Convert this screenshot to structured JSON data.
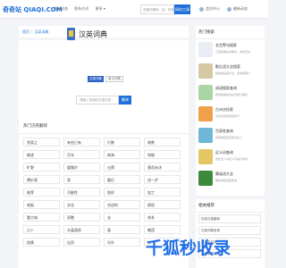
{
  "header": {
    "logo": "奇奇站 QIAQI.COM",
    "nav": [
      "新闻动态",
      "联系方式",
      "更多 ▾"
    ],
    "search_placeholder": "关键词搜索，如：短视频",
    "search_button": "网站工具",
    "user_a": "会员中心",
    "user_b": "最新动态"
  },
  "breadcrumb": {
    "home": "首页",
    "sep": "/",
    "current": "汉英词典"
  },
  "app": {
    "name": "汉英词典",
    "tag_primary": "汉英词典",
    "tag_secondary": "英汉词典"
  },
  "query": {
    "placeholder": "请输入查询的汉语词语",
    "button": "翻译"
  },
  "hot": {
    "title": "热门汉英翻译",
    "items": [
      "答案之",
      "有些已有",
      "行数",
      "装数",
      "概述",
      "百年",
      "商海",
      "铭物",
      "旷野",
      "缓慢步",
      "出殡",
      "悬而未决",
      "牌价表",
      "背",
      "最后",
      "进一步",
      "推荐",
      "可能性",
      "陪伴",
      "加工",
      "老板",
      "文化",
      "合适的",
      "债权",
      "重大城",
      "双胞",
      "去",
      "体系",
      "占卜",
      "水晶面前",
      "量",
      "集团",
      "陪情",
      "出资",
      "另外",
      "以"
    ]
  },
  "sidebar": {
    "title": "热门搜索",
    "apps": [
      {
        "name": "名言警句搜索",
        "desc": "汇聚经典名言警句，寻找灵感",
        "color": "#e9edf3"
      },
      {
        "name": "歇后语大全搜索",
        "desc": "精选歇后语大全，查询其释义",
        "color": "#d6c7a5"
      },
      {
        "name": "成语搜索查询",
        "desc": "搜索成语的出处及释义解析",
        "color": "#a9d6a3"
      },
      {
        "name": "古诗文检索",
        "desc": "古诗文检索阅读学习",
        "color": "#f0a24a"
      },
      {
        "name": "百家姓查询",
        "desc": "百家姓起源历史及名人",
        "color": "#6fb7d9"
      },
      {
        "name": "近义词查询",
        "desc": "查找近义词反义词进行替换",
        "color": "#e6c766"
      },
      {
        "name": "猜谜语大全",
        "desc": "趣味谜语谜底查询",
        "color": "#3d8a3d"
      }
    ],
    "tags_title": "相关推荐",
    "tags": [
      "在线汉英翻译",
      "汉英词典查询",
      "中英文互译",
      "英语单词查询"
    ]
  },
  "watermark": "千狐秒收录"
}
